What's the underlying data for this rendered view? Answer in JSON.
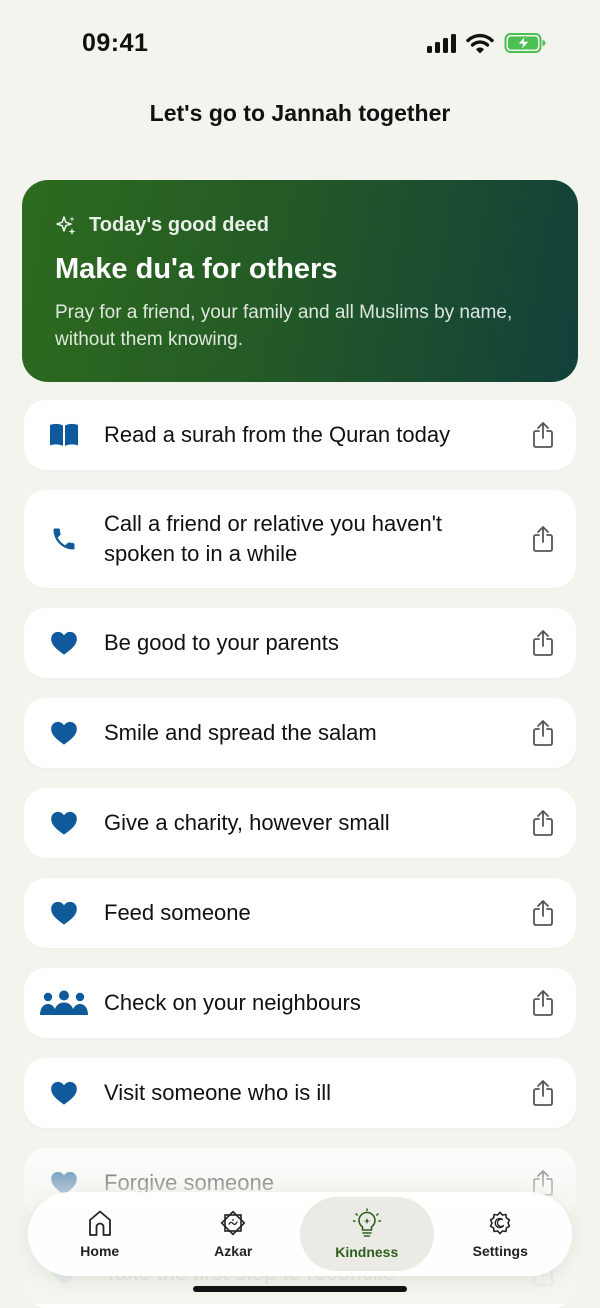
{
  "status": {
    "time": "09:41"
  },
  "header": {
    "title": "Let's go to Jannah together"
  },
  "featured": {
    "eyebrow": "Today's good deed",
    "title": "Make du'a for others",
    "description": "Pray for a friend, your family and all Muslims by name, without them knowing."
  },
  "deeds": [
    {
      "icon": "book-icon",
      "text": "Read a surah from the Quran today"
    },
    {
      "icon": "phone-icon",
      "text": "Call a friend or relative you haven't spoken to in a while"
    },
    {
      "icon": "heart-icon",
      "text": "Be good to your parents"
    },
    {
      "icon": "heart-icon",
      "text": "Smile and spread the salam"
    },
    {
      "icon": "heart-icon",
      "text": "Give a charity, however small"
    },
    {
      "icon": "heart-icon",
      "text": "Feed someone"
    },
    {
      "icon": "people-icon",
      "text": "Check on your neighbours"
    },
    {
      "icon": "heart-icon",
      "text": "Visit someone who is ill"
    },
    {
      "icon": "heart-icon",
      "text": "Forgive someone"
    },
    {
      "icon": "heart-icon",
      "text": "Take the first step to reconcile"
    }
  ],
  "tabs": [
    {
      "label": "Home",
      "icon": "home-icon"
    },
    {
      "label": "Azkar",
      "icon": "azkar-icon"
    },
    {
      "label": "Kindness",
      "icon": "lightbulb-icon",
      "active": true
    },
    {
      "label": "Settings",
      "icon": "gear-icon"
    }
  ],
  "colors": {
    "accent_green": "#2e5f1e",
    "icon_blue": "#0e5a9a",
    "featured_gradient_start": "#2d6b1e",
    "featured_gradient_end": "#12403a"
  }
}
